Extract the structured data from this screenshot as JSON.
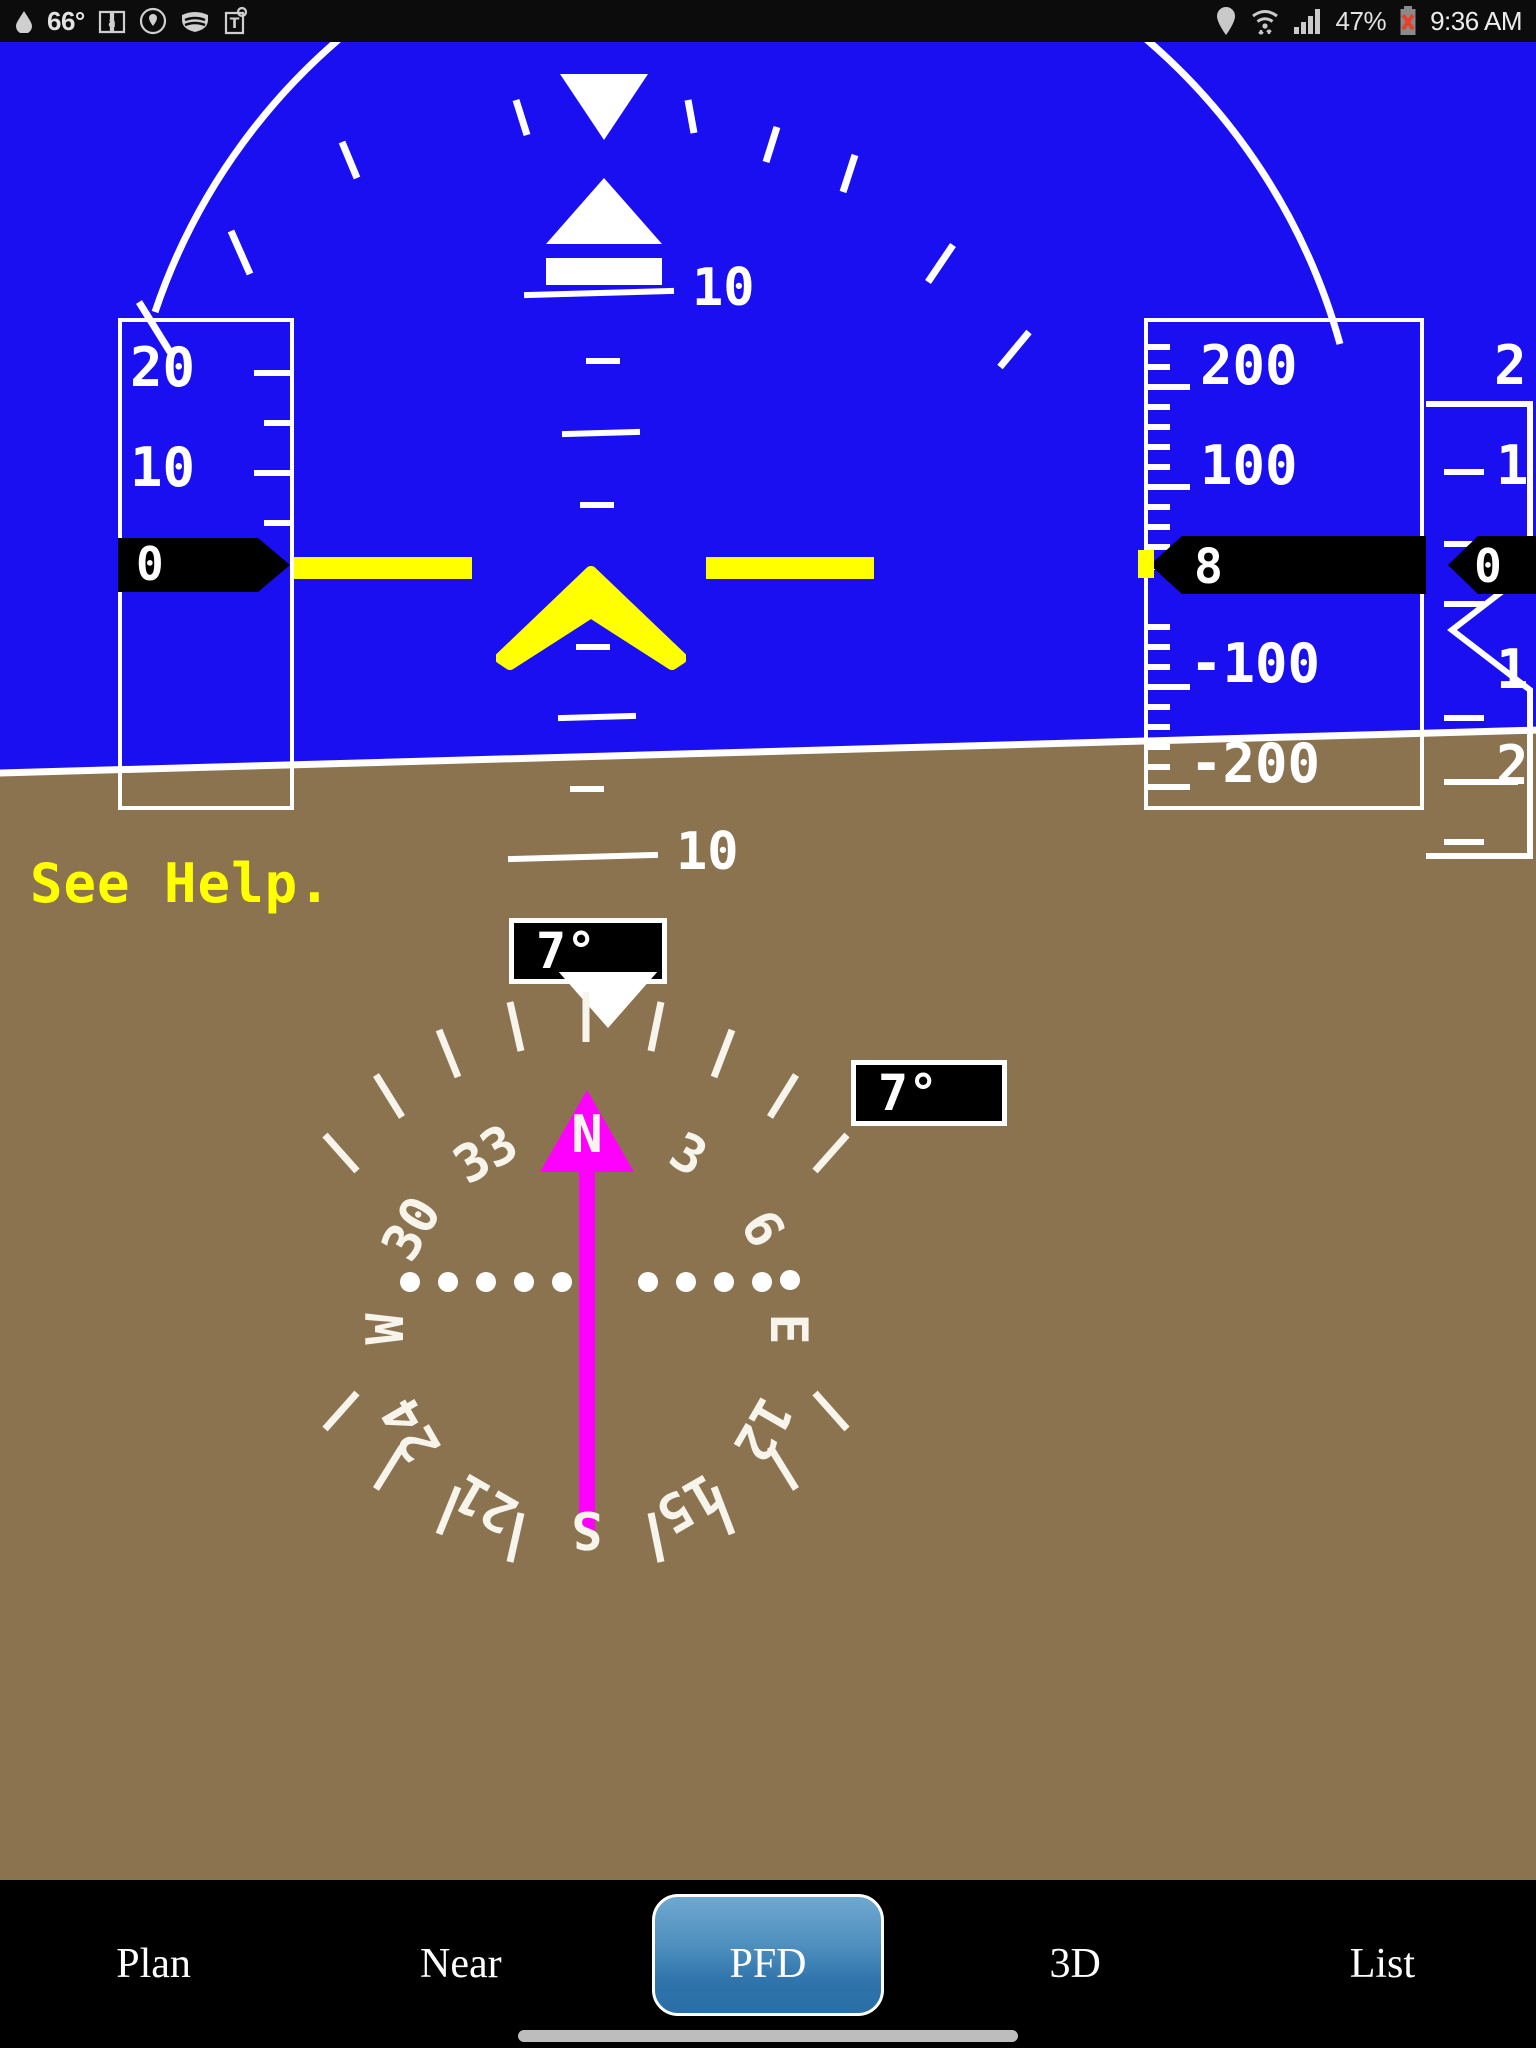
{
  "status_bar": {
    "temperature": "66°",
    "left_icons": [
      "droplet-icon",
      "amazon-kindle-icon",
      "location-shield-icon",
      "vpn-shield-icon",
      "t-mobile-tag-icon"
    ],
    "right_icons": [
      "location-pin-icon",
      "wifi-icon",
      "cell-signal-icon",
      "battery-error-icon"
    ],
    "battery_percent": "47%",
    "time": "9:36 AM"
  },
  "pfd": {
    "help_message": "See Help.",
    "colors": {
      "sky": "#1a0ff0",
      "ground": "#8b7350",
      "horizon": "#ffffff",
      "aircraft_symbol": "#ffff00",
      "heading_bug": "#ff00ff",
      "readout_background": "#000000"
    },
    "pitch_ladder": {
      "labels": [
        "10",
        "10"
      ],
      "upper_label": "10",
      "lower_label": "10"
    },
    "airspeed_tape": {
      "label": "airspeed",
      "scale_values": [
        "20",
        "10",
        "0"
      ],
      "current_value": "0"
    },
    "altitude_tape": {
      "label": "altitude",
      "scale_values": [
        "200",
        "100",
        "-100",
        "-200"
      ],
      "current_value": "8"
    },
    "vertical_speed_tape": {
      "label": "vertical-speed",
      "scale_values": [
        "2",
        "1",
        "1",
        "2"
      ],
      "current_value": "0"
    },
    "heading_readout": "7°",
    "track_readout": "7°",
    "compass": {
      "cardinal_labels": [
        "N",
        "3",
        "6",
        "E",
        "12",
        "15",
        "S",
        "21",
        "24",
        "W",
        "30",
        "33"
      ]
    }
  },
  "tabbar": {
    "tabs": [
      {
        "label": "Plan",
        "active": false
      },
      {
        "label": "Near",
        "active": false
      },
      {
        "label": "PFD",
        "active": true
      },
      {
        "label": "3D",
        "active": false
      },
      {
        "label": "List",
        "active": false
      }
    ]
  }
}
